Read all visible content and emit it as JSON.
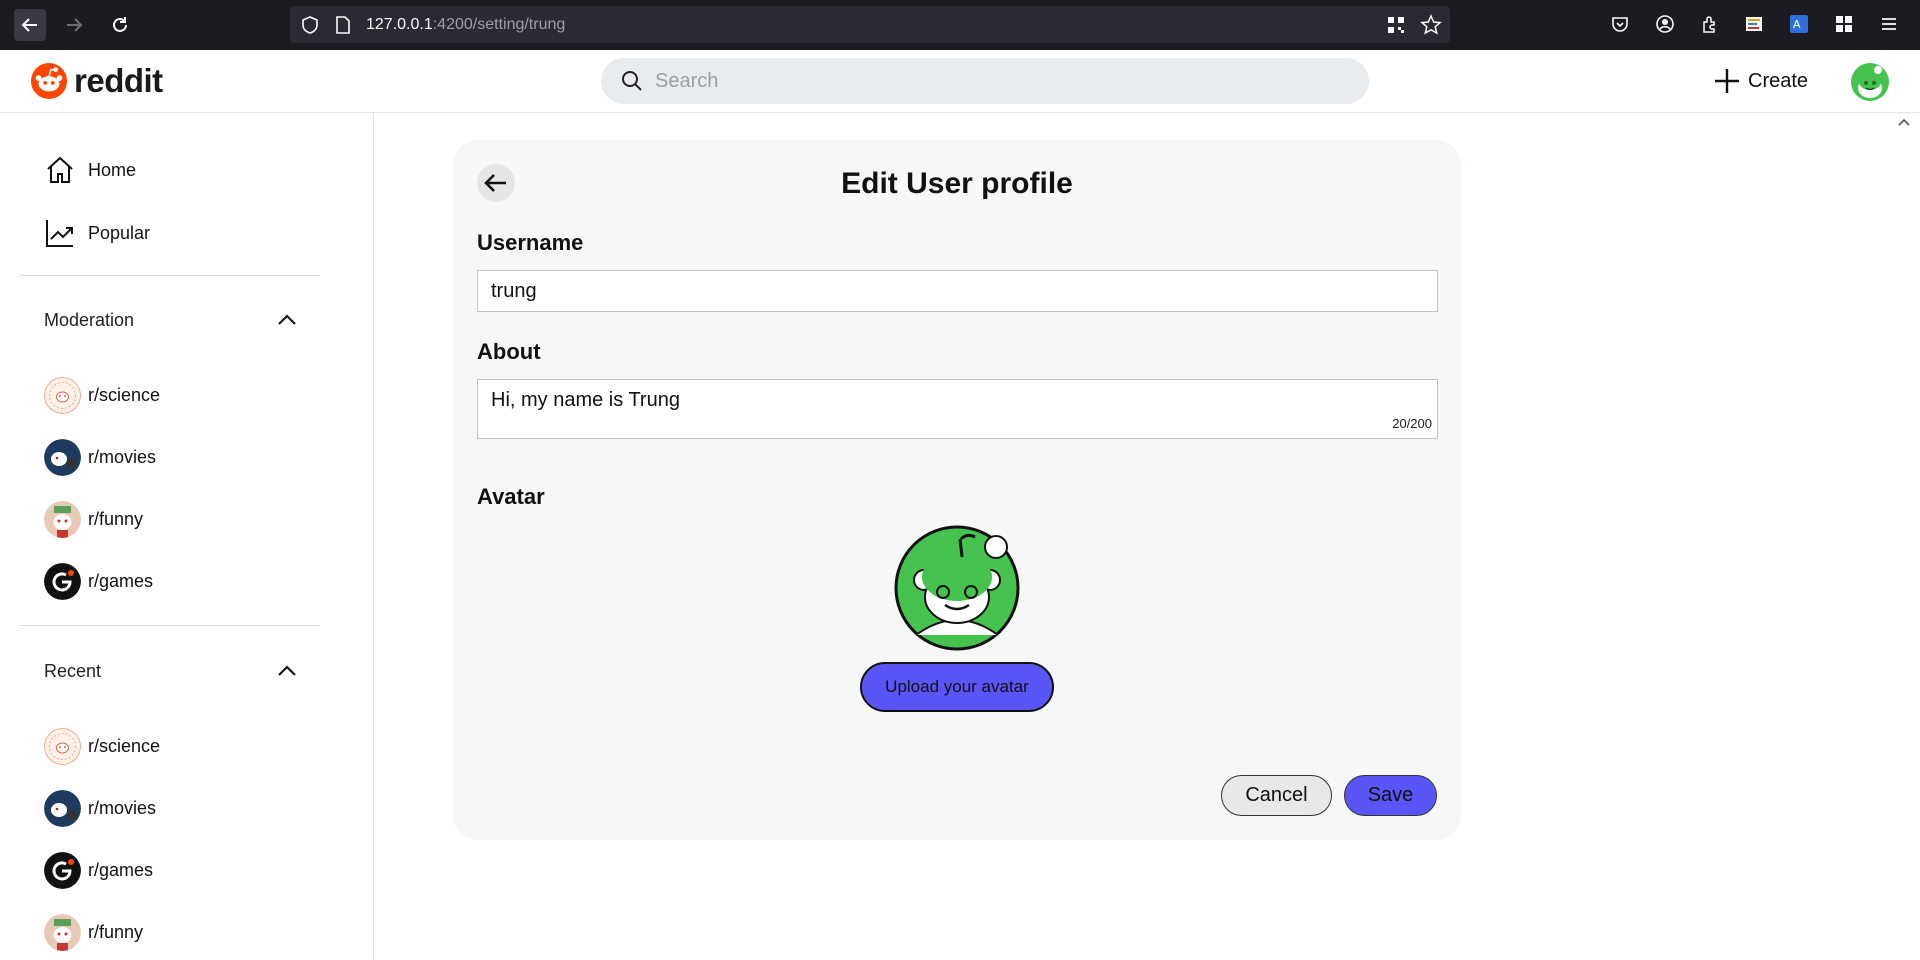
{
  "browser": {
    "url_host": "127.0.0.1",
    "url_path": ":4200/setting/trung"
  },
  "header": {
    "logo_text": "reddit",
    "search_placeholder": "Search",
    "create_label": "Create"
  },
  "sidebar": {
    "nav": [
      {
        "label": "Home",
        "icon": "home-icon"
      },
      {
        "label": "Popular",
        "icon": "trending-icon"
      }
    ],
    "moderation": {
      "title": "Moderation",
      "items": [
        "r/science",
        "r/movies",
        "r/funny",
        "r/games"
      ]
    },
    "recent": {
      "title": "Recent",
      "items": [
        "r/science",
        "r/movies",
        "r/games",
        "r/funny"
      ]
    }
  },
  "form": {
    "title": "Edit User profile",
    "username_label": "Username",
    "username_value": "trung",
    "about_label": "About",
    "about_value": "Hi, my name is Trung",
    "about_count": "20/200",
    "avatar_label": "Avatar",
    "upload_label": "Upload your avatar",
    "cancel_label": "Cancel",
    "save_label": "Save"
  },
  "colors": {
    "accent": "#5a55f6",
    "reddit_orange": "#ff4500",
    "avatar_green": "#46c34f"
  }
}
